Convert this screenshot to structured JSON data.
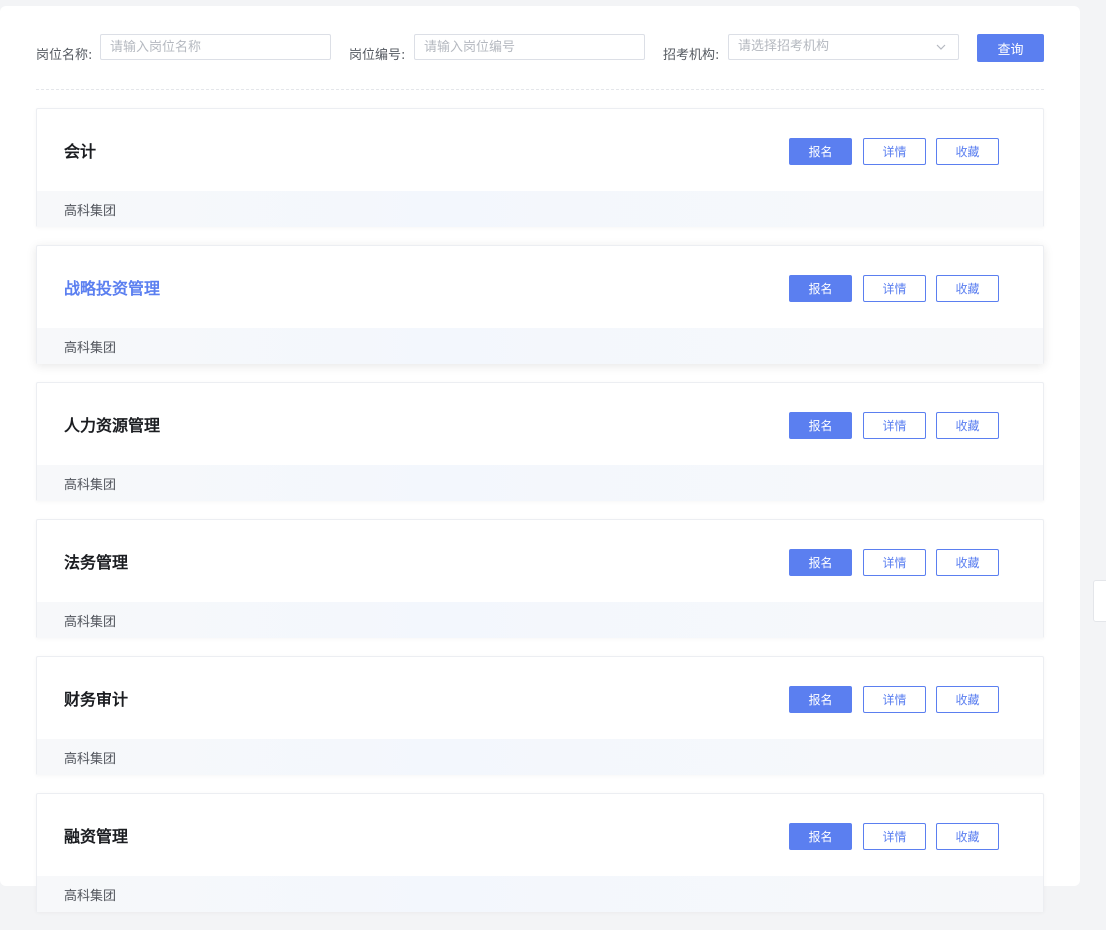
{
  "search": {
    "name_label": "岗位名称:",
    "name_placeholder": "请输入岗位名称",
    "code_label": "岗位编号:",
    "code_placeholder": "请输入岗位编号",
    "org_label": "招考机构:",
    "org_placeholder": "请选择招考机构",
    "query_label": "查询"
  },
  "jobs": [
    {
      "title": "会计",
      "org": "高科集团",
      "apply": "报名",
      "detail": "详情",
      "favorite": "收藏"
    },
    {
      "title": "战略投资管理",
      "org": "高科集团",
      "apply": "报名",
      "detail": "详情",
      "favorite": "收藏"
    },
    {
      "title": "人力资源管理",
      "org": "高科集团",
      "apply": "报名",
      "detail": "详情",
      "favorite": "收藏"
    },
    {
      "title": "法务管理",
      "org": "高科集团",
      "apply": "报名",
      "detail": "详情",
      "favorite": "收藏"
    },
    {
      "title": "财务审计",
      "org": "高科集团",
      "apply": "报名",
      "detail": "详情",
      "favorite": "收藏"
    },
    {
      "title": "融资管理",
      "org": "高科集团",
      "apply": "报名",
      "detail": "详情",
      "favorite": "收藏"
    }
  ],
  "icons": {
    "select_chevron": "chevron-down-icon"
  },
  "colors": {
    "accent": "#5b7ff0",
    "title": "#1b1d21",
    "footer_bg": "#f5f7fa"
  }
}
